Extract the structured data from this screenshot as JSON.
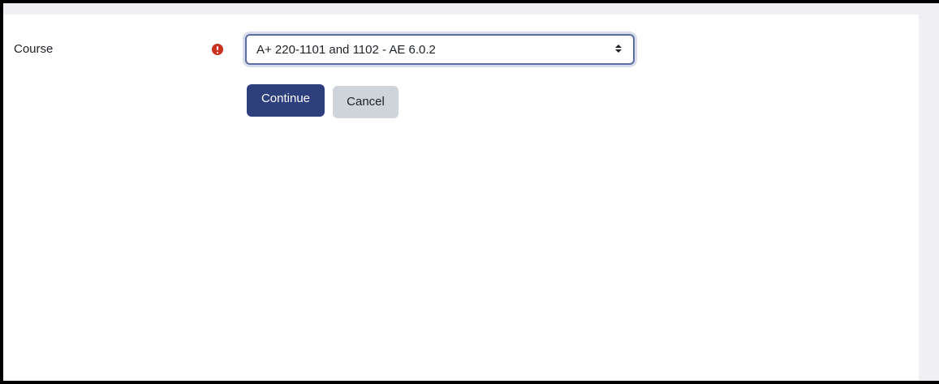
{
  "form": {
    "course_label": "Course",
    "required_icon": "exclamation-circle-icon",
    "course_select": {
      "selected_value": "A+ 220-1101 and 1102 - AE 6.0.2"
    },
    "continue_label": "Continue",
    "cancel_label": "Cancel"
  },
  "colors": {
    "primary": "#2e3f7e",
    "secondary": "#ced4da",
    "required": "#ca3120",
    "focus_border": "#5b6d9e"
  }
}
